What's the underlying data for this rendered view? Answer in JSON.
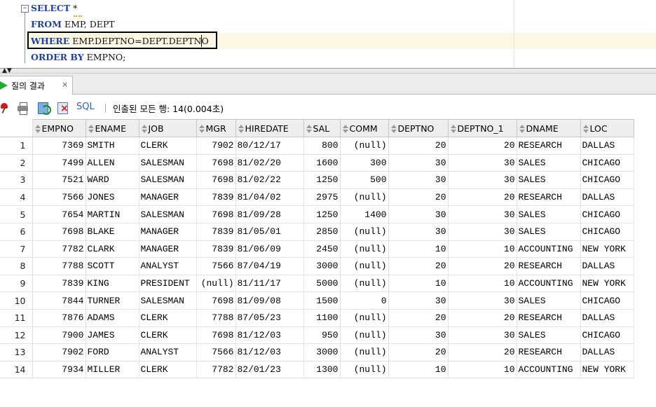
{
  "editor": {
    "fold_glyph": "−",
    "lines": [
      {
        "kw": "SELECT",
        "rest": " *"
      },
      {
        "kw": "FROM",
        "rest": " EMP, DEPT"
      },
      {
        "kw": "WHERE",
        "rest": " EMP.DEPTNO=DEPT.DEPTNO"
      },
      {
        "kw": "ORDER BY",
        "rest": " EMPNO;"
      }
    ]
  },
  "results_tab": {
    "label": "질의 결과",
    "close": "×"
  },
  "toolbar": {
    "sql_label": "SQL",
    "fetch_status": "인출된 모든 행: 14(0.004초)"
  },
  "grid": {
    "columns": [
      "EMPNO",
      "ENAME",
      "JOB",
      "MGR",
      "HIREDATE",
      "SAL",
      "COMM",
      "DEPTNO",
      "DEPTNO_1",
      "DNAME",
      "LOC"
    ],
    "rows": [
      [
        "1",
        "7369",
        "SMITH",
        "CLERK",
        "7902",
        "80/12/17",
        "800",
        "(null)",
        "20",
        "20",
        "RESEARCH",
        "DALLAS"
      ],
      [
        "2",
        "7499",
        "ALLEN",
        "SALESMAN",
        "7698",
        "81/02/20",
        "1600",
        "300",
        "30",
        "30",
        "SALES",
        "CHICAGO"
      ],
      [
        "3",
        "7521",
        "WARD",
        "SALESMAN",
        "7698",
        "81/02/22",
        "1250",
        "500",
        "30",
        "30",
        "SALES",
        "CHICAGO"
      ],
      [
        "4",
        "7566",
        "JONES",
        "MANAGER",
        "7839",
        "81/04/02",
        "2975",
        "(null)",
        "20",
        "20",
        "RESEARCH",
        "DALLAS"
      ],
      [
        "5",
        "7654",
        "MARTIN",
        "SALESMAN",
        "7698",
        "81/09/28",
        "1250",
        "1400",
        "30",
        "30",
        "SALES",
        "CHICAGO"
      ],
      [
        "6",
        "7698",
        "BLAKE",
        "MANAGER",
        "7839",
        "81/05/01",
        "2850",
        "(null)",
        "30",
        "30",
        "SALES",
        "CHICAGO"
      ],
      [
        "7",
        "7782",
        "CLARK",
        "MANAGER",
        "7839",
        "81/06/09",
        "2450",
        "(null)",
        "10",
        "10",
        "ACCOUNTING",
        "NEW YORK"
      ],
      [
        "8",
        "7788",
        "SCOTT",
        "ANALYST",
        "7566",
        "87/04/19",
        "3000",
        "(null)",
        "20",
        "20",
        "RESEARCH",
        "DALLAS"
      ],
      [
        "9",
        "7839",
        "KING",
        "PRESIDENT",
        "(null)",
        "81/11/17",
        "5000",
        "(null)",
        "10",
        "10",
        "ACCOUNTING",
        "NEW YORK"
      ],
      [
        "10",
        "7844",
        "TURNER",
        "SALESMAN",
        "7698",
        "81/09/08",
        "1500",
        "0",
        "30",
        "30",
        "SALES",
        "CHICAGO"
      ],
      [
        "11",
        "7876",
        "ADAMS",
        "CLERK",
        "7788",
        "87/05/23",
        "1100",
        "(null)",
        "20",
        "20",
        "RESEARCH",
        "DALLAS"
      ],
      [
        "12",
        "7900",
        "JAMES",
        "CLERK",
        "7698",
        "81/12/03",
        "950",
        "(null)",
        "30",
        "30",
        "SALES",
        "CHICAGO"
      ],
      [
        "13",
        "7902",
        "FORD",
        "ANALYST",
        "7566",
        "81/12/03",
        "3000",
        "(null)",
        "20",
        "20",
        "RESEARCH",
        "DALLAS"
      ],
      [
        "14",
        "7934",
        "MILLER",
        "CLERK",
        "7782",
        "82/01/23",
        "1300",
        "(null)",
        "10",
        "10",
        "ACCOUNTING",
        "NEW YORK"
      ]
    ]
  },
  "colors": {
    "keyword": "#2040a0",
    "run_icon": "#1fae30",
    "sql_link": "#2a62c8",
    "current_line": "#fcf7e2"
  },
  "icons": [
    "pin-icon",
    "print-icon",
    "refresh-icon",
    "delete-icon",
    "run-icon",
    "fold-icon",
    "sort-icon"
  ]
}
